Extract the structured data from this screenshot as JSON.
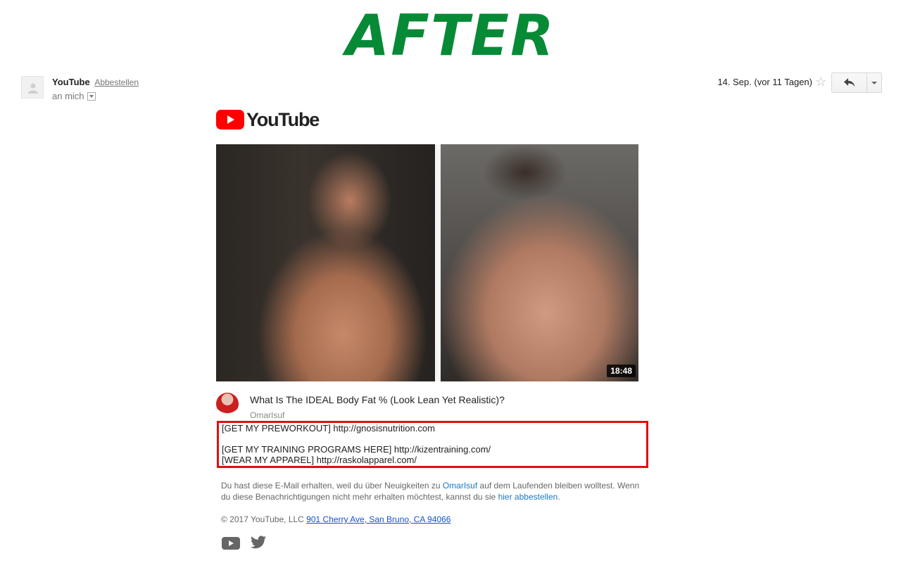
{
  "banner": {
    "text": "AFTER",
    "color": "#078a36"
  },
  "email": {
    "sender_name": "YouTube",
    "unsubscribe_label": "Abbestellen",
    "recipient_label": "an mich",
    "date": "14. Sep. (vor 11 Tagen)",
    "icons": {
      "avatar": "person-icon",
      "star": "star-icon",
      "reply": "reply-icon",
      "more": "chevron-down-icon"
    }
  },
  "brand": {
    "wordmark": "YouTube",
    "logo_color": "#ff0000"
  },
  "video": {
    "duration": "18:48",
    "title": "What Is The IDEAL Body Fat % (Look Lean Yet Realistic)?",
    "channel": "OmarIsuf"
  },
  "description": {
    "line1": "[GET MY PREWORKOUT] http://gnosisnutrition.com",
    "line2": "[GET MY TRAINING PROGRAMS HERE] http://kizentraining.com/",
    "line3": "[WEAR MY APPAREL] http://raskolapparel.com/",
    "highlight_color": "#e01010"
  },
  "footer": {
    "text_before": "Du hast diese E-Mail erhalten, weil du über Neuigkeiten zu ",
    "channel_link": "OmarIsuf",
    "text_middle": " auf dem Laufenden bleiben wolltest. Wenn du diese Benachrichtigungen nicht mehr erhalten möchtest, kannst du sie ",
    "unsubscribe_link": "hier abbestellen",
    "text_after": ".",
    "copyright": "© 2017 YouTube, LLC ",
    "address": "901 Cherry Ave, San Bruno, CA 94066",
    "social": [
      "youtube-icon",
      "twitter-icon"
    ]
  }
}
